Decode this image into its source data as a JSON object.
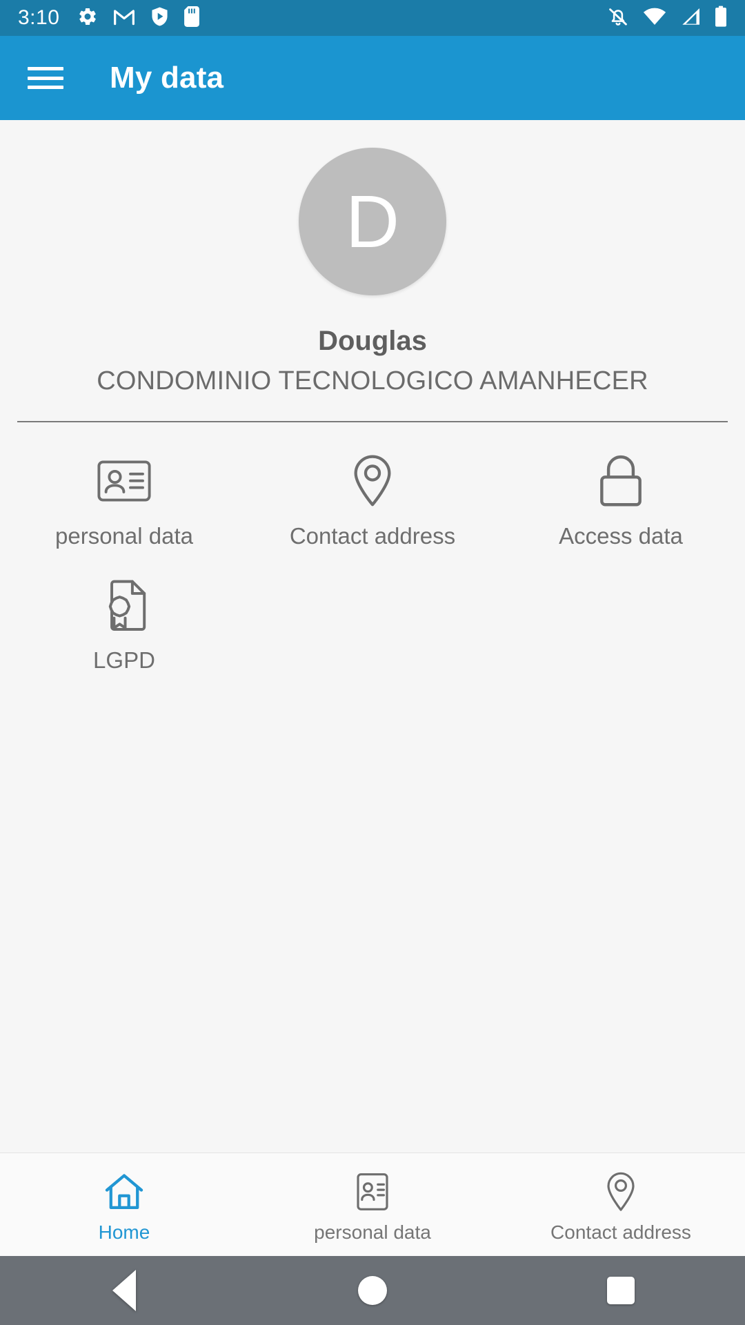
{
  "status_bar": {
    "time": "3:10",
    "left_icons": [
      "gear-icon",
      "gmail-icon",
      "play-protect-shield-icon",
      "sd-card-icon"
    ],
    "right_icons": [
      "notifications-silenced-icon",
      "wifi-icon",
      "cellular-signal-icon",
      "battery-full-icon"
    ],
    "background_color": "#1b7ca8"
  },
  "app_bar": {
    "menu_icon": "hamburger-menu-icon",
    "title": "My data",
    "background_color": "#1b95d0",
    "text_color": "#ffffff"
  },
  "profile": {
    "avatar_initial": "D",
    "avatar_color": "#bdbdbd",
    "name": "Douglas",
    "organization": "CONDOMINIO TECNOLOGICO AMANHECER"
  },
  "grid": {
    "items": [
      {
        "label": "personal data",
        "icon": "contact-card-icon"
      },
      {
        "label": "Contact address",
        "icon": "map-pin-icon"
      },
      {
        "label": "Access data",
        "icon": "lock-icon"
      },
      {
        "label": "LGPD",
        "icon": "document-certificate-icon"
      }
    ]
  },
  "bottom_nav": {
    "active_color": "#2196d3",
    "inactive_color": "#757575",
    "items": [
      {
        "label": "Home",
        "icon": "home-icon",
        "active": true
      },
      {
        "label": "personal data",
        "icon": "contact-card-icon",
        "active": false
      },
      {
        "label": "Contact address",
        "icon": "map-pin-icon",
        "active": false
      }
    ]
  },
  "system_nav": {
    "back": "back-triangle-icon",
    "home": "home-circle-icon",
    "recents": "recents-square-icon",
    "background_color": "#6b7076"
  }
}
